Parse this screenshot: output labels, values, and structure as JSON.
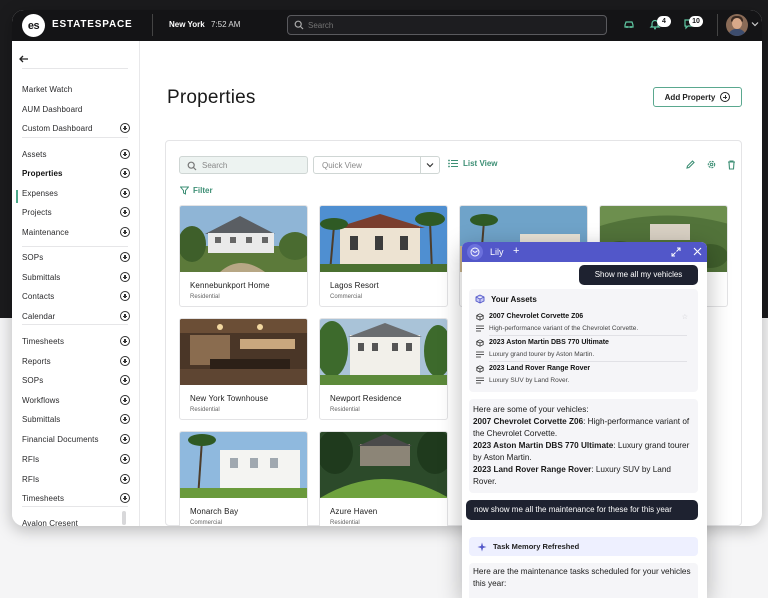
{
  "topbar": {
    "logo": "es",
    "brand": "ESTATESPACE",
    "city": "New York",
    "time": "7:52 AM",
    "search_placeholder": "Search",
    "icons": [
      "car-icon",
      "bell-icon",
      "chat-icon"
    ],
    "notifications_count": "4",
    "messages_count": "10"
  },
  "sidebar": {
    "items": [
      {
        "label": "Market Watch",
        "plus": false
      },
      {
        "label": "AUM Dashboard",
        "plus": false
      },
      {
        "label": "Custom Dashboard",
        "plus": true
      },
      {
        "label": "Assets",
        "plus": true
      },
      {
        "label": "Properties",
        "plus": true,
        "active": true
      },
      {
        "label": "Expenses",
        "plus": true
      },
      {
        "label": "Projects",
        "plus": true
      },
      {
        "label": "Maintenance",
        "plus": true
      },
      {
        "label": "SOPs",
        "plus": true
      },
      {
        "label": "Submittals",
        "plus": true
      },
      {
        "label": "Contacts",
        "plus": true
      },
      {
        "label": "Calendar",
        "plus": true
      },
      {
        "label": "Timesheets",
        "plus": true
      },
      {
        "label": "Reports",
        "plus": true
      },
      {
        "label": "SOPs",
        "plus": true
      },
      {
        "label": "Workflows",
        "plus": true
      },
      {
        "label": "Submittals",
        "plus": true
      },
      {
        "label": "Financial Documents",
        "plus": true
      },
      {
        "label": "RFIs",
        "plus": true
      },
      {
        "label": "RFIs",
        "plus": true
      },
      {
        "label": "Timesheets",
        "plus": true
      },
      {
        "label": "Avalon Cresent",
        "plus": false
      }
    ]
  },
  "main": {
    "title": "Properties",
    "add_button": "Add Property",
    "search_placeholder": "Search",
    "quick_view": "Quick View",
    "list_view": "List View",
    "filter": "Filter",
    "properties": [
      {
        "name": "Kennebunkport Home",
        "type": "Residential"
      },
      {
        "name": "Lagos Resort",
        "type": "Commercial"
      },
      {
        "name": "",
        "type": ""
      },
      {
        "name": "",
        "type": ""
      },
      {
        "name": "New York Townhouse",
        "type": "Residential"
      },
      {
        "name": "Newport Residence",
        "type": "Residential"
      },
      {
        "name": "Monarch Bay",
        "type": "Commercial"
      },
      {
        "name": "Azure Haven",
        "type": "Residential"
      }
    ]
  },
  "chat": {
    "title": "Lily",
    "user_message_1": "Show me all my vehicles",
    "assets_header": "Your Assets",
    "assets": [
      {
        "name": "2007 Chevrolet Corvette Z06",
        "description": "High-performance variant of the Chevrolet Corvette."
      },
      {
        "name": "2023 Aston Martin DBS 770 Ultimate",
        "description": "Luxury grand tourer by Aston Martin."
      },
      {
        "name": "2023 Land Rover Range Rover",
        "description": "Luxury SUV by Land Rover."
      }
    ],
    "reply_intro": "Here are some of your vehicles:",
    "reply_items": [
      {
        "name": "2007 Chevrolet Corvette Z06",
        "text": ": High-performance variant of the Chevrolet Corvette."
      },
      {
        "name": "2023 Aston Martin DBS 770 Ultimate",
        "text": ": Luxury grand tourer by Aston Martin."
      },
      {
        "name": "2023 Land Rover Range Rover",
        "text": ": Luxury SUV by Land Rover."
      }
    ],
    "user_message_2": "now show me all the maintenance for these for this year",
    "memory_notice": "Task Memory Refreshed",
    "reply_2": "Here are the maintenance tasks scheduled for your vehicles this year:"
  },
  "colors": {
    "accent_green": "#3d8f75",
    "chat_header": "#5257c9",
    "topbar": "#141416"
  }
}
